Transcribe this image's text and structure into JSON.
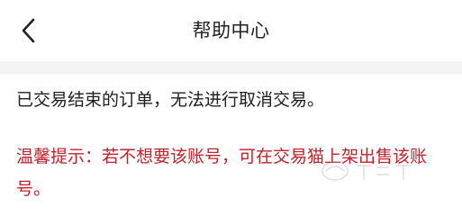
{
  "header": {
    "back_icon": "chevron-left-icon",
    "title": "帮助中心"
  },
  "content": {
    "message": "已交易结束的订单，无法进行取消交易。",
    "tip": "温馨提示：若不想要该账号，可在交易猫上架出售该账号。"
  },
  "colors": {
    "tip": "#c0232b",
    "text": "#1e1e1e",
    "divider": "#f4f4f4"
  }
}
